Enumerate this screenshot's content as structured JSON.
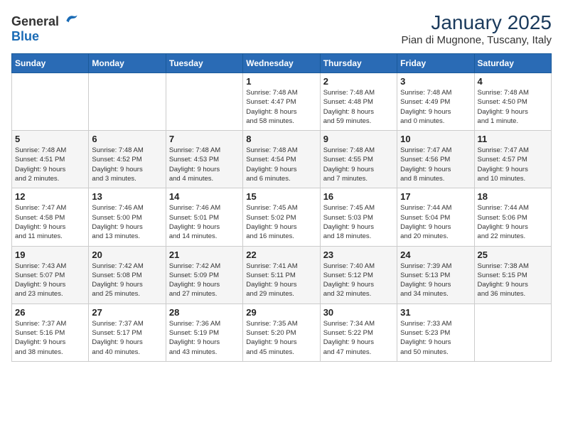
{
  "header": {
    "logo_general": "General",
    "logo_blue": "Blue",
    "month": "January 2025",
    "location": "Pian di Mugnone, Tuscany, Italy"
  },
  "weekdays": [
    "Sunday",
    "Monday",
    "Tuesday",
    "Wednesday",
    "Thursday",
    "Friday",
    "Saturday"
  ],
  "rows": [
    {
      "shaded": false,
      "cells": [
        {
          "day": "",
          "info": ""
        },
        {
          "day": "",
          "info": ""
        },
        {
          "day": "",
          "info": ""
        },
        {
          "day": "1",
          "info": "Sunrise: 7:48 AM\nSunset: 4:47 PM\nDaylight: 8 hours\nand 58 minutes."
        },
        {
          "day": "2",
          "info": "Sunrise: 7:48 AM\nSunset: 4:48 PM\nDaylight: 8 hours\nand 59 minutes."
        },
        {
          "day": "3",
          "info": "Sunrise: 7:48 AM\nSunset: 4:49 PM\nDaylight: 9 hours\nand 0 minutes."
        },
        {
          "day": "4",
          "info": "Sunrise: 7:48 AM\nSunset: 4:50 PM\nDaylight: 9 hours\nand 1 minute."
        }
      ]
    },
    {
      "shaded": true,
      "cells": [
        {
          "day": "5",
          "info": "Sunrise: 7:48 AM\nSunset: 4:51 PM\nDaylight: 9 hours\nand 2 minutes."
        },
        {
          "day": "6",
          "info": "Sunrise: 7:48 AM\nSunset: 4:52 PM\nDaylight: 9 hours\nand 3 minutes."
        },
        {
          "day": "7",
          "info": "Sunrise: 7:48 AM\nSunset: 4:53 PM\nDaylight: 9 hours\nand 4 minutes."
        },
        {
          "day": "8",
          "info": "Sunrise: 7:48 AM\nSunset: 4:54 PM\nDaylight: 9 hours\nand 6 minutes."
        },
        {
          "day": "9",
          "info": "Sunrise: 7:48 AM\nSunset: 4:55 PM\nDaylight: 9 hours\nand 7 minutes."
        },
        {
          "day": "10",
          "info": "Sunrise: 7:47 AM\nSunset: 4:56 PM\nDaylight: 9 hours\nand 8 minutes."
        },
        {
          "day": "11",
          "info": "Sunrise: 7:47 AM\nSunset: 4:57 PM\nDaylight: 9 hours\nand 10 minutes."
        }
      ]
    },
    {
      "shaded": false,
      "cells": [
        {
          "day": "12",
          "info": "Sunrise: 7:47 AM\nSunset: 4:58 PM\nDaylight: 9 hours\nand 11 minutes."
        },
        {
          "day": "13",
          "info": "Sunrise: 7:46 AM\nSunset: 5:00 PM\nDaylight: 9 hours\nand 13 minutes."
        },
        {
          "day": "14",
          "info": "Sunrise: 7:46 AM\nSunset: 5:01 PM\nDaylight: 9 hours\nand 14 minutes."
        },
        {
          "day": "15",
          "info": "Sunrise: 7:45 AM\nSunset: 5:02 PM\nDaylight: 9 hours\nand 16 minutes."
        },
        {
          "day": "16",
          "info": "Sunrise: 7:45 AM\nSunset: 5:03 PM\nDaylight: 9 hours\nand 18 minutes."
        },
        {
          "day": "17",
          "info": "Sunrise: 7:44 AM\nSunset: 5:04 PM\nDaylight: 9 hours\nand 20 minutes."
        },
        {
          "day": "18",
          "info": "Sunrise: 7:44 AM\nSunset: 5:06 PM\nDaylight: 9 hours\nand 22 minutes."
        }
      ]
    },
    {
      "shaded": true,
      "cells": [
        {
          "day": "19",
          "info": "Sunrise: 7:43 AM\nSunset: 5:07 PM\nDaylight: 9 hours\nand 23 minutes."
        },
        {
          "day": "20",
          "info": "Sunrise: 7:42 AM\nSunset: 5:08 PM\nDaylight: 9 hours\nand 25 minutes."
        },
        {
          "day": "21",
          "info": "Sunrise: 7:42 AM\nSunset: 5:09 PM\nDaylight: 9 hours\nand 27 minutes."
        },
        {
          "day": "22",
          "info": "Sunrise: 7:41 AM\nSunset: 5:11 PM\nDaylight: 9 hours\nand 29 minutes."
        },
        {
          "day": "23",
          "info": "Sunrise: 7:40 AM\nSunset: 5:12 PM\nDaylight: 9 hours\nand 32 minutes."
        },
        {
          "day": "24",
          "info": "Sunrise: 7:39 AM\nSunset: 5:13 PM\nDaylight: 9 hours\nand 34 minutes."
        },
        {
          "day": "25",
          "info": "Sunrise: 7:38 AM\nSunset: 5:15 PM\nDaylight: 9 hours\nand 36 minutes."
        }
      ]
    },
    {
      "shaded": false,
      "cells": [
        {
          "day": "26",
          "info": "Sunrise: 7:37 AM\nSunset: 5:16 PM\nDaylight: 9 hours\nand 38 minutes."
        },
        {
          "day": "27",
          "info": "Sunrise: 7:37 AM\nSunset: 5:17 PM\nDaylight: 9 hours\nand 40 minutes."
        },
        {
          "day": "28",
          "info": "Sunrise: 7:36 AM\nSunset: 5:19 PM\nDaylight: 9 hours\nand 43 minutes."
        },
        {
          "day": "29",
          "info": "Sunrise: 7:35 AM\nSunset: 5:20 PM\nDaylight: 9 hours\nand 45 minutes."
        },
        {
          "day": "30",
          "info": "Sunrise: 7:34 AM\nSunset: 5:22 PM\nDaylight: 9 hours\nand 47 minutes."
        },
        {
          "day": "31",
          "info": "Sunrise: 7:33 AM\nSunset: 5:23 PM\nDaylight: 9 hours\nand 50 minutes."
        },
        {
          "day": "",
          "info": ""
        }
      ]
    }
  ]
}
